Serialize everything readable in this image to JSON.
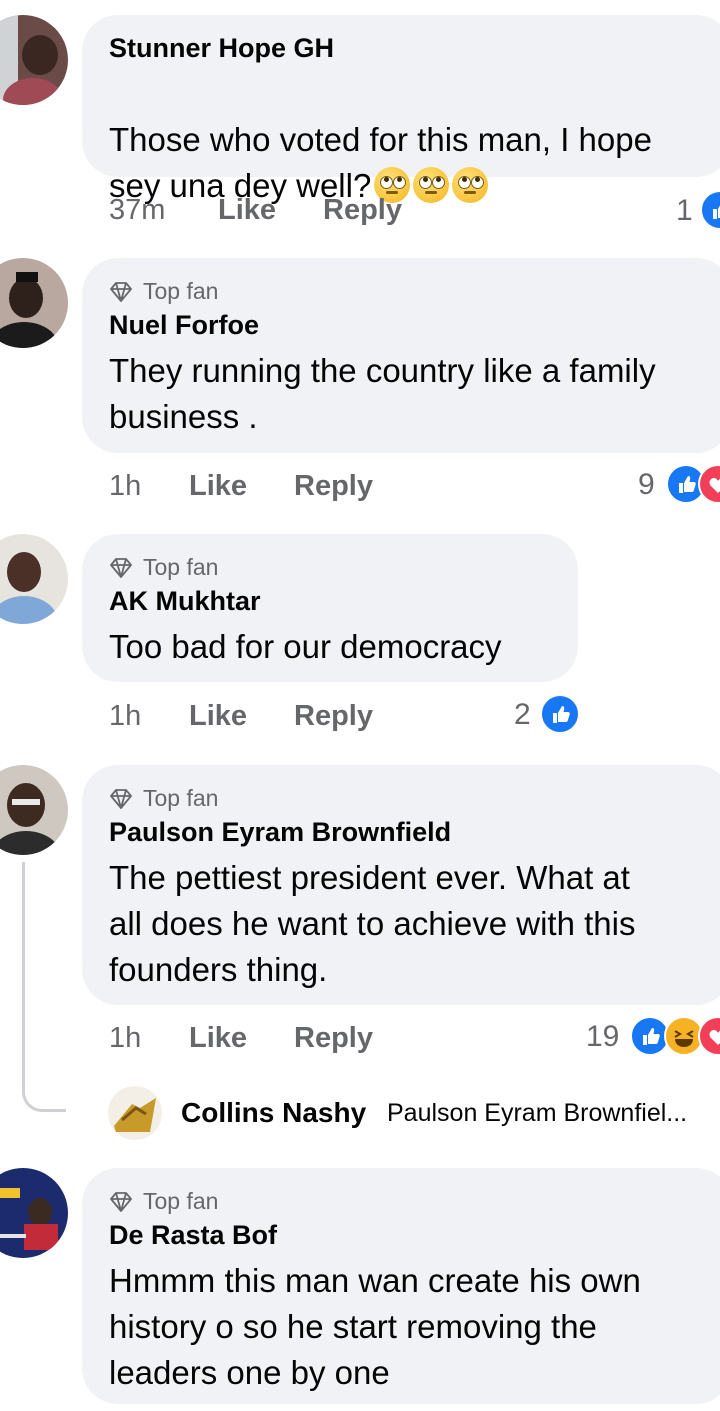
{
  "comments": [
    {
      "name": "Stunner Hope GH",
      "top_fan": false,
      "text": "Those who voted for this man, I hope\nsey una dey well?",
      "emojis": [
        "face-with-rolling-eyes",
        "face-with-rolling-eyes",
        "face-with-rolling-eyes"
      ],
      "time": "37m",
      "like_label": "Like",
      "reply_label": "Reply",
      "reaction_count": "1",
      "reactions": [
        "like"
      ]
    },
    {
      "name": "Nuel Forfoe",
      "top_fan": true,
      "top_fan_label": "Top fan",
      "text": "They running the country like a family\nbusiness .",
      "time": "1h",
      "like_label": "Like",
      "reply_label": "Reply",
      "reaction_count": "9",
      "reactions": [
        "like",
        "love"
      ]
    },
    {
      "name": "AK Mukhtar",
      "top_fan": true,
      "top_fan_label": "Top fan",
      "text": "Too bad for our democracy",
      "time": "1h",
      "like_label": "Like",
      "reply_label": "Reply",
      "reaction_count": "2",
      "reactions": [
        "like"
      ]
    },
    {
      "name": "Paulson Eyram Brownfield",
      "top_fan": true,
      "top_fan_label": "Top fan",
      "text": "The pettiest president ever. What at\nall does he want to achieve with this\nfounders thing.",
      "time": "1h",
      "like_label": "Like",
      "reply_label": "Reply",
      "reaction_count": "19",
      "reactions": [
        "like",
        "haha",
        "love"
      ]
    },
    {
      "name": "De Rasta Bof",
      "top_fan": true,
      "top_fan_label": "Top fan",
      "text": "Hmmm this man wan create his own\nhistory o so he start removing the\nleaders one by one"
    }
  ],
  "reply_preview": {
    "name": "Collins Nashy",
    "snippet": "Paulson Eyram Brownfiel..."
  },
  "colors": {
    "bubble": "#f0f2f5",
    "meta_text": "#65676b",
    "like_blue": "#1877f2",
    "love_red": "#f33e58",
    "haha_yellow": "#f7b125"
  }
}
